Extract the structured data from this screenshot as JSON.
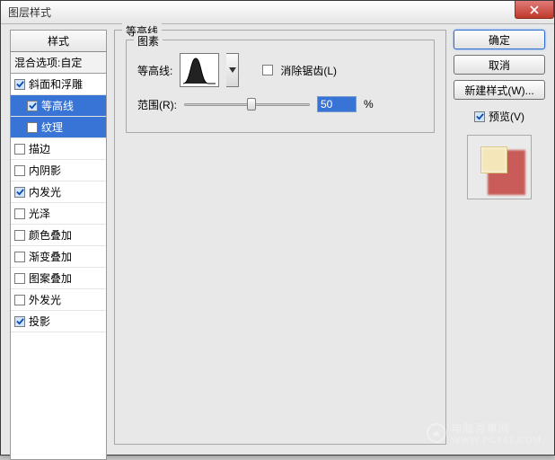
{
  "window": {
    "title": "图层样式"
  },
  "styles": {
    "header": "样式",
    "blend_row": "混合选项:自定",
    "items": [
      {
        "label": "斜面和浮雕",
        "checked": true,
        "selected": false,
        "sub": false
      },
      {
        "label": "等高线",
        "checked": true,
        "selected": true,
        "sub": true
      },
      {
        "label": "纹理",
        "checked": false,
        "selected": true,
        "sub": true
      },
      {
        "label": "描边",
        "checked": false,
        "selected": false,
        "sub": false
      },
      {
        "label": "内阴影",
        "checked": false,
        "selected": false,
        "sub": false
      },
      {
        "label": "内发光",
        "checked": true,
        "selected": false,
        "sub": false
      },
      {
        "label": "光泽",
        "checked": false,
        "selected": false,
        "sub": false
      },
      {
        "label": "颜色叠加",
        "checked": false,
        "selected": false,
        "sub": false
      },
      {
        "label": "渐变叠加",
        "checked": false,
        "selected": false,
        "sub": false
      },
      {
        "label": "图案叠加",
        "checked": false,
        "selected": false,
        "sub": false
      },
      {
        "label": "外发光",
        "checked": false,
        "selected": false,
        "sub": false
      },
      {
        "label": "投影",
        "checked": true,
        "selected": false,
        "sub": false
      }
    ]
  },
  "panel": {
    "group_title": "等高线",
    "elements_title": "图素",
    "contour_label": "等高线:",
    "anti_alias": "消除锯齿(L)",
    "anti_alias_checked": false,
    "range_label": "范围(R):",
    "range_value": "50",
    "range_unit": "%"
  },
  "buttons": {
    "ok": "确定",
    "cancel": "取消",
    "new_style": "新建样式(W)...",
    "preview": "预览(V)",
    "preview_checked": true
  },
  "watermark": {
    "text": "电脑百事网",
    "sub": "WWW.PC841.COM"
  }
}
